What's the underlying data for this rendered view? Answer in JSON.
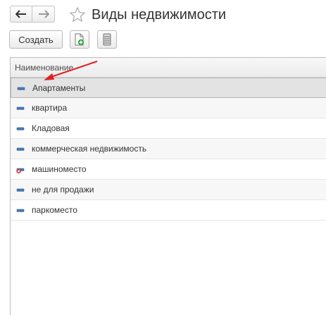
{
  "window": {
    "title": "Виды недвижимости"
  },
  "toolbar": {
    "create_label": "Создать"
  },
  "table": {
    "column_header": "Наименование",
    "rows": [
      {
        "label": "Апартаменты",
        "status": "normal",
        "selected": true
      },
      {
        "label": "квартира",
        "status": "normal",
        "selected": false
      },
      {
        "label": "Кладовая",
        "status": "normal",
        "selected": false
      },
      {
        "label": "коммерческая недвижимость",
        "status": "normal",
        "selected": false
      },
      {
        "label": "машиноместо",
        "status": "marked-for-deletion",
        "selected": false
      },
      {
        "label": "не для продажи",
        "status": "normal",
        "selected": false
      },
      {
        "label": "паркоместо",
        "status": "normal",
        "selected": false
      }
    ]
  },
  "icons": {
    "back": "arrow-left-icon",
    "forward": "arrow-right-icon",
    "favorite": "star-icon",
    "copy": "add-document-icon",
    "list": "list-icon",
    "item": "catalog-item-icon",
    "deleted": "delete-mark-icon",
    "annotation": "red-arrow-annotation"
  },
  "colors": {
    "item_icon": "#4a7ab5",
    "delete_mark": "#d62b2b",
    "annotation_arrow": "#e02020",
    "selected_row": "#e3e3e3",
    "copy_icon": "#3aa84a"
  }
}
